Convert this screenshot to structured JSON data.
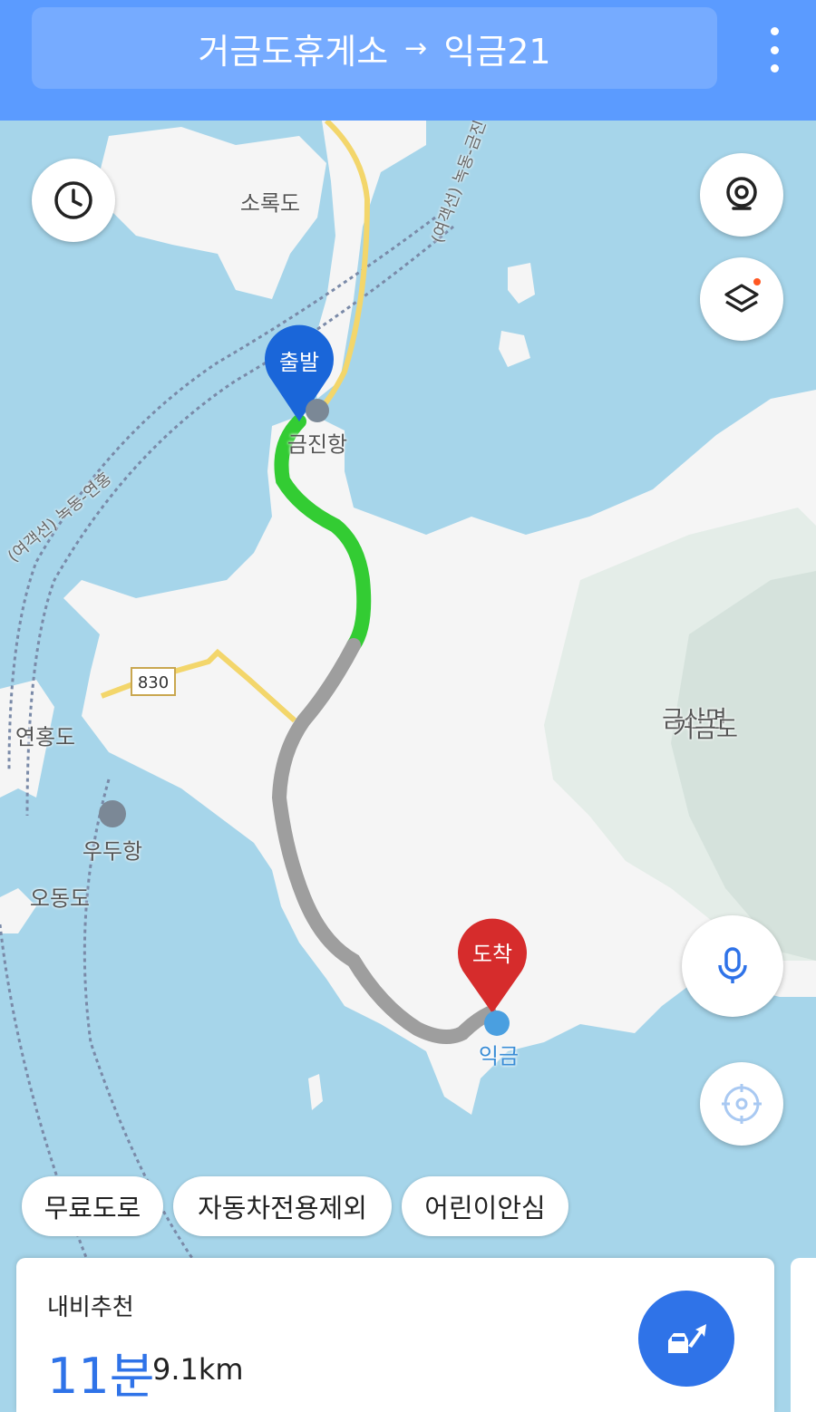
{
  "header": {
    "origin": "거금도휴게소",
    "arrow": "→",
    "destination": "익금21"
  },
  "map": {
    "markers": {
      "start": "출발",
      "end": "도착"
    },
    "labels": {
      "sorokdo": "소록도",
      "geumjinhang": "금진항",
      "yeonhongdo": "연홍도",
      "uduhang": "우두항",
      "odongdo": "오동도",
      "geumsanmyeon": "금산면",
      "geogeumdo": "거금도",
      "ikgeum": "익금",
      "road_number": "830",
      "sea_route_1": "(여객선) 녹동-금진",
      "sea_route_2": "(여객선) 녹동-연홍"
    },
    "route_colors": {
      "congestion_free": "#33cc33",
      "no_info": "#9e9e9e"
    }
  },
  "chips": [
    "무료도로",
    "자동차전용제외",
    "어린이안심"
  ],
  "route_card": {
    "title": "내비추천",
    "time": "11분",
    "distance": "9.1km"
  },
  "colors": {
    "accent": "#2f73e8",
    "header": "#5b9bff",
    "start_marker": "#1a66d9",
    "end_marker": "#d62c2c"
  }
}
